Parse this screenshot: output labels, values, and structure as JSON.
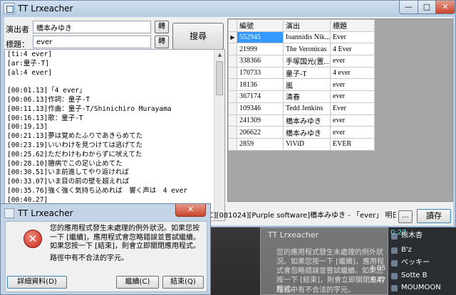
{
  "window": {
    "title": "TT Lrxeacher",
    "min": "—",
    "max": "□",
    "close": "✕"
  },
  "search": {
    "artist_label": "演出者",
    "artist_value": "橋本みゆき",
    "title_label": "標題：",
    "title_value": "ever",
    "convert_label": "轉",
    "search_label": "搜尋"
  },
  "lyrics": "[ti:4 ever]\n[ar:童子-T]\n[al:4 ever]\n\n[00:01.13]「4 ever」\n[00:06.13]作詞：童子-T\n[00:11.13]作曲：童子-T/Shinichiro Murayama\n[00:16.13]歌：童子-T\n[00:19.13]\n[00:21.13]夢は覚めたふりであきらめてた\n[00:23.19]いいわけを見つけては逃げてた\n[00:25.62]ただわけもわからずに吠えてた\n[00:28.10]臆病でこの足い止めてた\n[00:30.51]いま前進してやり返ければ\n[00:33.07]いま目の前の壁を超えれば\n[00:35.76]強く強く気持ち込めれば　響く声は　4 ever\n[00:40.27]",
  "grid": {
    "columns": [
      "編號",
      "演出",
      "標題"
    ],
    "rows": [
      {
        "num": "552945",
        "artist": "Ioannidis Nik...",
        "title": "Ever"
      },
      {
        "num": "21999",
        "artist": "The Veronicas",
        "title": "4 Ever"
      },
      {
        "num": "338366",
        "artist": "手塚国光(置...",
        "title": "ever"
      },
      {
        "num": "170733",
        "artist": "童子-T",
        "title": "4 ever"
      },
      {
        "num": "18136",
        "artist": "嵐",
        "title": "ever"
      },
      {
        "num": "367174",
        "artist": "清春",
        "title": "ever"
      },
      {
        "num": "109346",
        "artist": "Tedd Jenkins",
        "title": "Ever"
      },
      {
        "num": "241309",
        "artist": "橋本みゆき",
        "title": " ever"
      },
      {
        "num": "206622",
        "artist": "橋本みゆき",
        "title": "ever"
      },
      {
        "num": "2859",
        "artist": "ViViD",
        "title": "EVER"
      }
    ]
  },
  "status_text": "AC][081024][Purple software]橋本みゆき - 「ever」 明日の七洛",
  "dots_label": "...",
  "read_label": "讀存",
  "dialog": {
    "title": "TT Lrxeacher",
    "close": "✕",
    "message": "您的應用程式發生未處理的例外狀況。如果您按一下 [繼續]，應用程式會忽略錯誤並嘗試繼續。如果您按一下 [結束]，則會立即關閉應用程式。",
    "detail": "路徑中有不合法的字元。",
    "details_button": "詳細資料(D)",
    "continue_button": "繼續(C)",
    "quit_button": "結束(Q)"
  },
  "background": {
    "times": [
      "0:27",
      "4:05",
      "3:47"
    ],
    "items": [
      "熊木杏",
      "B'z",
      "ベッキー",
      "Sotte B",
      "MOUMOON"
    ],
    "ghost_title": "TT Lrxeacher",
    "ghost_message": "您的應用程式發生未處理的例外狀況。如果您按一下 [繼續]，應用程式會忽略錯誤並嘗試繼續。如果您按一下 [結束]，則會立即關閉應用程式。",
    "ghost_detail": "路徑中有不合法的字元。"
  }
}
